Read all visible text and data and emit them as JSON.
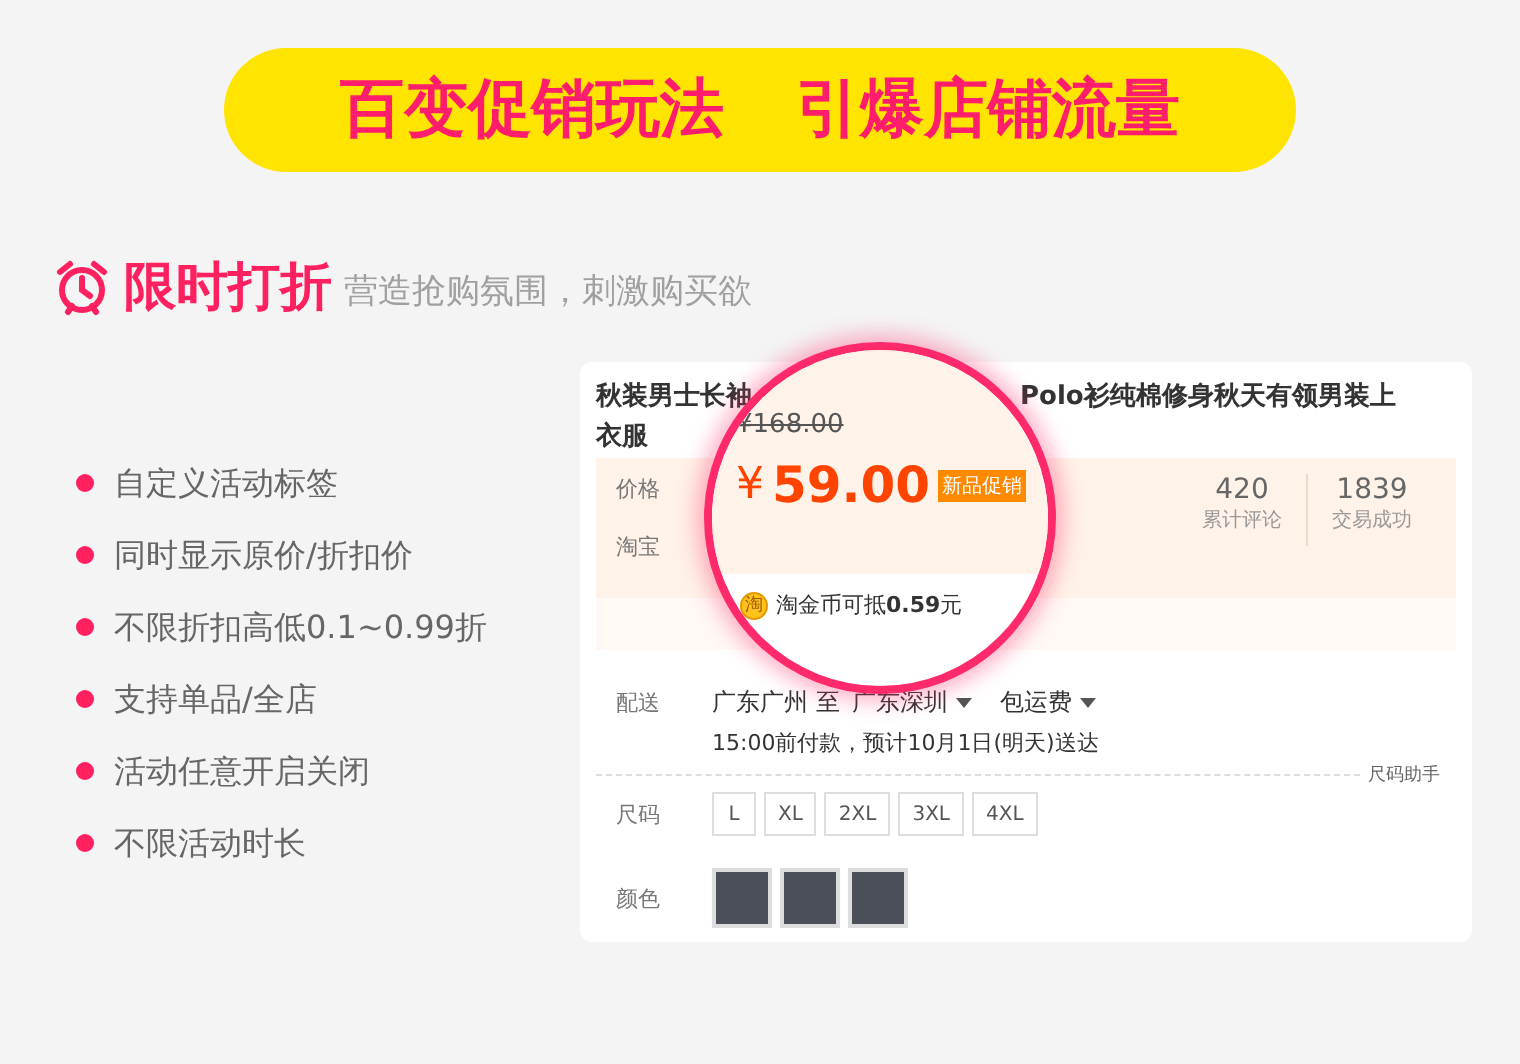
{
  "banner": {
    "title": "百变促销玩法",
    "subtitle": "引爆店铺流量"
  },
  "section": {
    "title": "限时打折",
    "tagline": "营造抢购氛围，刺激购买欲"
  },
  "features": [
    "自定义活动标签",
    "同时显示原价/折扣价",
    "不限折扣高低0.1~0.99折",
    "支持单品/全店",
    "活动任意开启关闭",
    "不限活动时长"
  ],
  "product": {
    "title_start": "秋装男士长袖",
    "title_end": "Polo衫纯棉修身秋天有领男装上",
    "title_line2": "衣服",
    "price_label": "价格",
    "taobao_label": "淘宝",
    "stats": [
      {
        "value": "420",
        "label": "累计评论"
      },
      {
        "value": "1839",
        "label": "交易成功"
      }
    ],
    "delivery": {
      "label": "配送",
      "from": "广东广州 至",
      "to": "广东深圳",
      "fee": "包运费",
      "eta": "15:00前付款，预计10月1日(明天)送达"
    },
    "size_helper": "尺码助手",
    "size_label": "尺码",
    "sizes": [
      "L",
      "XL",
      "2XL",
      "3XL",
      "4XL"
    ],
    "color_label": "颜色"
  },
  "magnifier": {
    "original_price": "¥168.00",
    "price_symbol": "¥",
    "price": "59.00",
    "badge": "新品促销",
    "coin_label": "淘",
    "coin_text_start": "淘金币可抵",
    "coin_amount": "0.59",
    "coin_text_end": "元"
  }
}
